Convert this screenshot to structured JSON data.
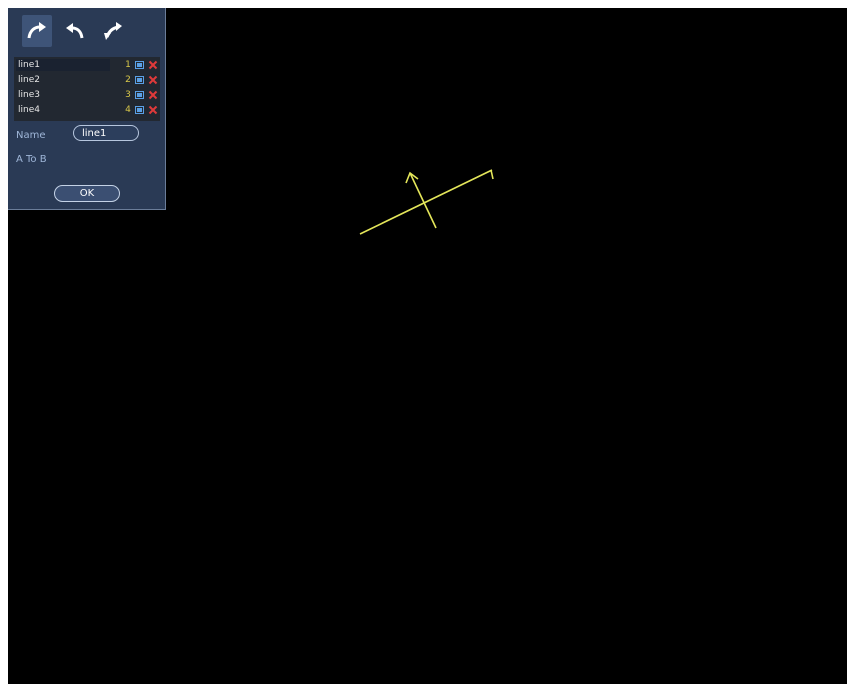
{
  "toolbar": {
    "buttons": [
      {
        "icon": "arrow-curve-right-icon",
        "active": true
      },
      {
        "icon": "undo-icon",
        "active": false
      },
      {
        "icon": "swap-direction-icon",
        "active": false
      }
    ]
  },
  "lines": {
    "items": [
      {
        "name": "line1",
        "index": "1"
      },
      {
        "name": "line2",
        "index": "2"
      },
      {
        "name": "line3",
        "index": "3"
      },
      {
        "name": "line4",
        "index": "4"
      }
    ],
    "edit_icon": "edit-icon",
    "delete_icon": "delete-icon"
  },
  "form": {
    "name_label": "Name",
    "name_value": "line1",
    "direction": "A To B"
  },
  "ok_label": "OK",
  "colors": {
    "canvas": "#000000",
    "panel": "#2a3a55",
    "tripwire": "#e4e65a",
    "delete": "#e03a3a",
    "edit": "#5aa0e6"
  }
}
